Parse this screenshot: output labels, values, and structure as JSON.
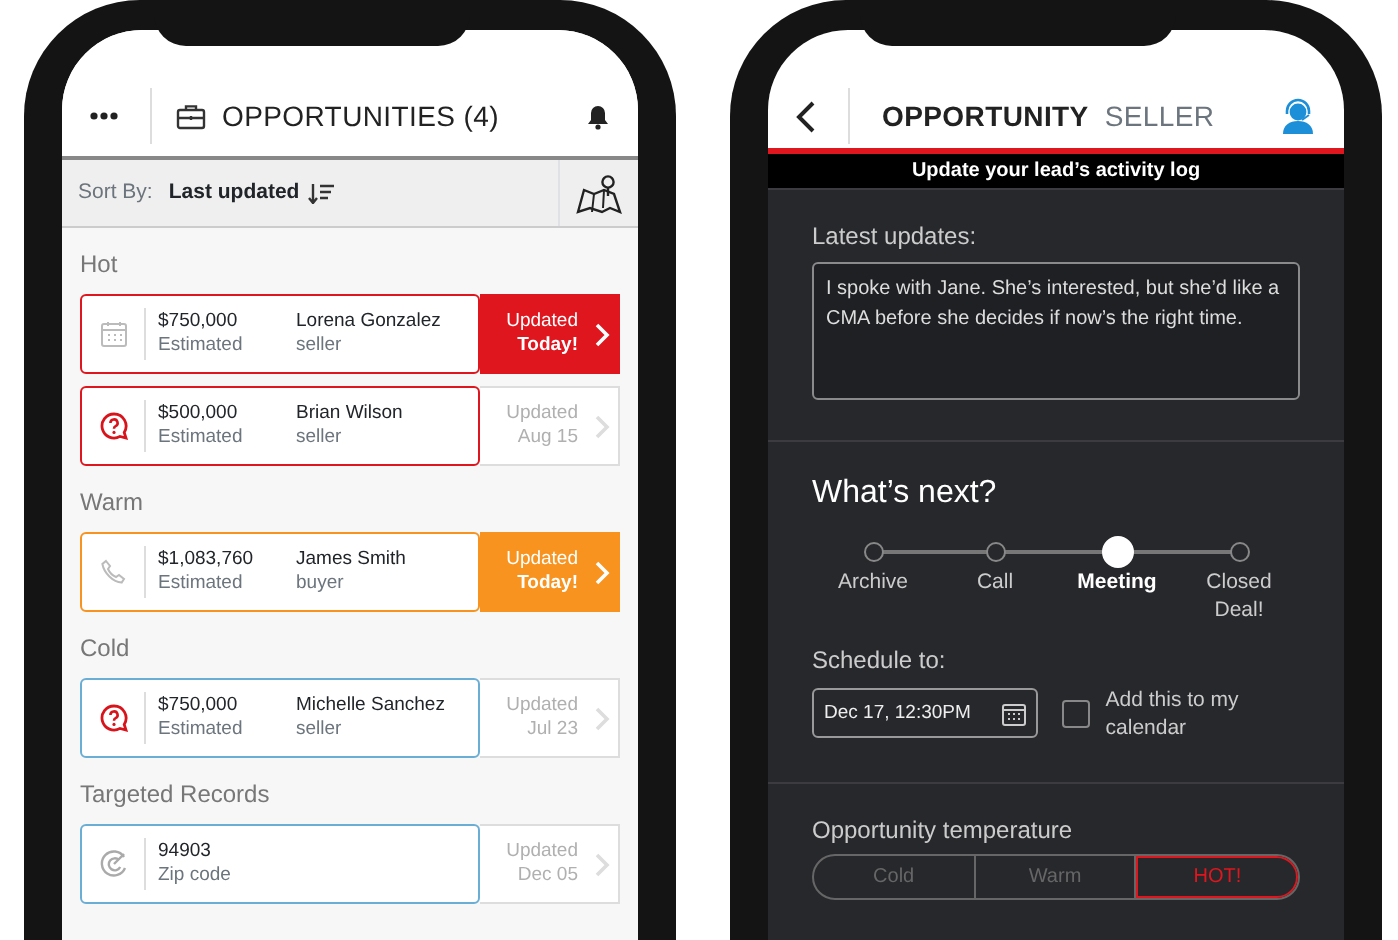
{
  "opportunities_screen": {
    "title": "OPPORTUNITIES (4)",
    "sort": {
      "label": "Sort By:",
      "value": "Last updated"
    },
    "groups": [
      {
        "title": "Hot",
        "items": [
          {
            "kind": "calendar",
            "amount": "$750,000",
            "amount_label": "Estimated",
            "name": "Lorena Gonzalez",
            "role": "seller",
            "updated_label": "Updated",
            "updated": "Today!",
            "color": "#e0161e",
            "highlighted": true
          },
          {
            "kind": "question",
            "amount": "$500,000",
            "amount_label": "Estimated",
            "name": "Brian Wilson",
            "role": "seller",
            "updated_label": "Updated",
            "updated": "Aug 15",
            "color": "#e0161e",
            "highlighted": false
          }
        ]
      },
      {
        "title": "Warm",
        "items": [
          {
            "kind": "phone",
            "amount": "$1,083,760",
            "amount_label": "Estimated",
            "name": "James Smith",
            "role": "buyer",
            "updated_label": "Updated",
            "updated": "Today!",
            "color": "#f7931e",
            "highlighted": true
          }
        ]
      },
      {
        "title": "Cold",
        "items": [
          {
            "kind": "question",
            "amount": "$750,000",
            "amount_label": "Estimated",
            "name": "Michelle Sanchez",
            "role": "seller",
            "updated_label": "Updated",
            "updated": "Jul 23",
            "color": "#6aaed6",
            "highlighted": false
          }
        ]
      },
      {
        "title": "Targeted Records",
        "items": [
          {
            "kind": "target",
            "amount": "94903",
            "amount_label": "Zip code",
            "updated_label": "Updated",
            "updated": "Dec 05",
            "color": "#6aaed6",
            "highlighted": false
          }
        ]
      }
    ]
  },
  "opportunity_screen": {
    "title": "OPPORTUNITY",
    "subtitle": "SELLER",
    "banner": "Update your lead’s activity log",
    "latest_updates": {
      "label": "Latest updates:",
      "value": "I spoke with Jane. She’s interested, but she’d like a CMA before she decides if now’s the right time."
    },
    "whats_next": {
      "title": "What’s next?",
      "steps": [
        {
          "label": "Archive",
          "selected": false
        },
        {
          "label": "Call",
          "selected": false
        },
        {
          "label": "Meeting",
          "selected": true
        },
        {
          "label": "Closed Deal!",
          "selected": false
        }
      ],
      "schedule_label": "Schedule to:",
      "date": "Dec 17, 12:30PM",
      "calendar_checkbox": {
        "label": "Add this to my calendar",
        "checked": false
      }
    },
    "temperature": {
      "label": "Opportunity temperature",
      "options": [
        {
          "label": "Cold",
          "selected": false
        },
        {
          "label": "Warm",
          "selected": false
        },
        {
          "label": "HOT!",
          "selected": true
        }
      ]
    }
  }
}
